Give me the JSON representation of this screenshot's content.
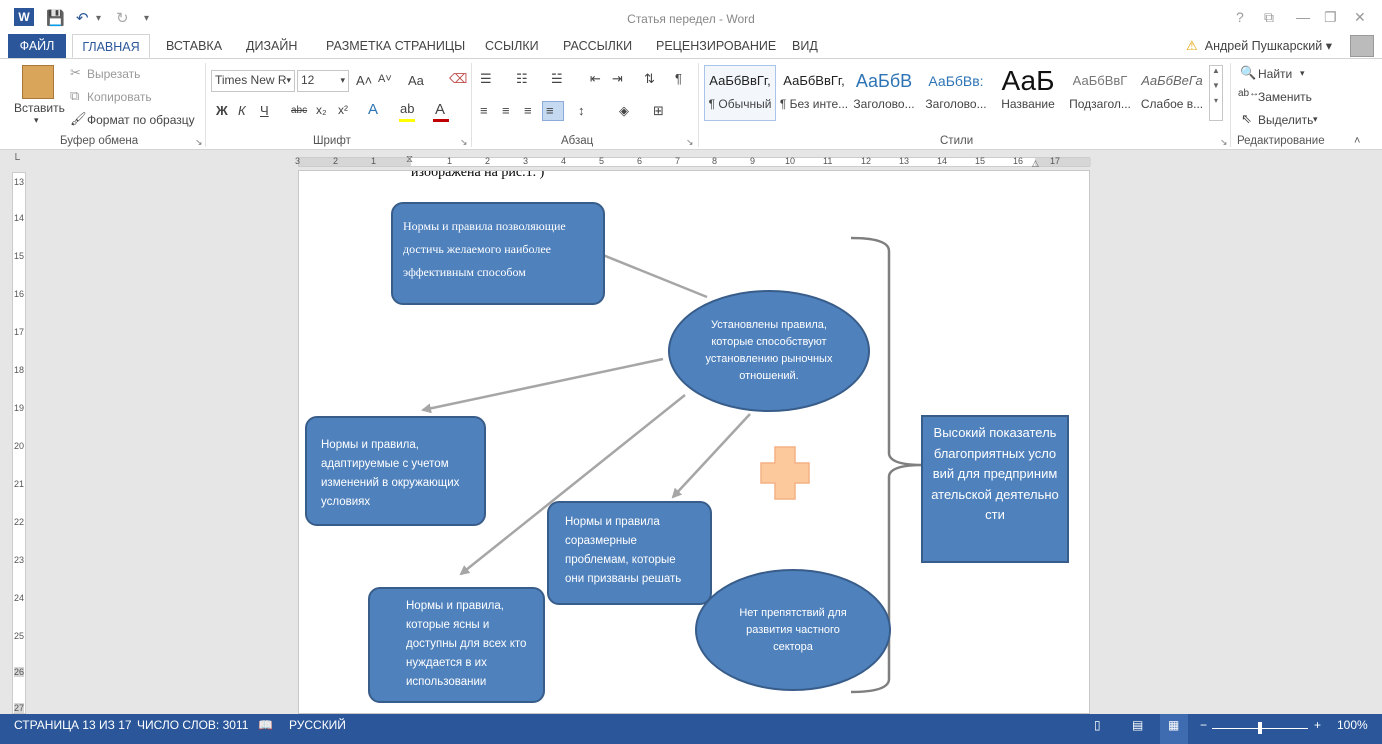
{
  "window": {
    "title": "Статья передел - Word",
    "controls": [
      "?",
      "⧉",
      "—",
      "❐",
      "✕"
    ]
  },
  "tabs": {
    "file": "ФАЙЛ",
    "items": [
      "ГЛАВНАЯ",
      "ВСТАВКА",
      "ДИЗАЙН",
      "РАЗМЕТКА СТРАНИЦЫ",
      "ССЫЛКИ",
      "РАССЫЛКИ",
      "РЕЦЕНЗИРОВАНИЕ",
      "ВИД"
    ],
    "active": "ГЛАВНАЯ",
    "user": "Андрей Пушкарский"
  },
  "ribbon": {
    "clipboard": {
      "paste": "Вставить",
      "cut": "Вырезать",
      "copy": "Копировать",
      "format_painter": "Формат по образцу",
      "label": "Буфер обмена"
    },
    "font": {
      "name": "Times New R",
      "size": "12",
      "label": "Шрифт",
      "bold": "Ж",
      "italic": "К",
      "underline": "Ч",
      "strike": "abc",
      "sub": "x₂",
      "sup": "x²",
      "grow": "A˄",
      "shrink": "A˅",
      "case": "Aa"
    },
    "paragraph": {
      "label": "Абзац"
    },
    "styles": {
      "label": "Стили",
      "items": [
        {
          "preview": "АаБбВвГг,",
          "name": "¶ Обычный"
        },
        {
          "preview": "АаБбВвГг,",
          "name": "¶ Без инте..."
        },
        {
          "preview": "АаБбВ",
          "name": "Заголово..."
        },
        {
          "preview": "АаБбВв:",
          "name": "Заголово..."
        },
        {
          "preview": "АаБ",
          "name": "Название"
        },
        {
          "preview": "АаБбВвГ",
          "name": "Подзагол..."
        },
        {
          "preview": "АаБбВеГа",
          "name": "Слабое в..."
        }
      ]
    },
    "editing": {
      "find": "Найти",
      "replace": "Заменить",
      "select": "Выделить",
      "label": "Редактирование"
    }
  },
  "ruler": {
    "h_ticks": [
      "3",
      "2",
      "1",
      "1",
      "2",
      "3",
      "4",
      "5",
      "6",
      "7",
      "8",
      "9",
      "10",
      "11",
      "12",
      "13",
      "14",
      "15",
      "16",
      "17"
    ],
    "v_ticks": [
      "13",
      "14",
      "15",
      "16",
      "17",
      "18",
      "19",
      "20",
      "21",
      "22",
      "23",
      "24",
      "25",
      "26",
      "27"
    ]
  },
  "document": {
    "top_text": "изображена на рис.1.  )",
    "box_top": "Нормы и правила позволяющие достичь желаемого наиболее эффективным способом",
    "ellipse_center": "Установлены правила, которые способствуют установлению рыночных отношений.",
    "box_left": "Нормы и правила, адаптируемые с учетом изменений в окружающих условиях",
    "box_mid": "Нормы и правила соразмерные проблемам, которые они призваны решать",
    "box_bottom": "Нормы и правила, которые ясны и доступны для всех кто нуждается в их использовании",
    "ellipse_bottom": "Нет препятствий для развития частного сектора",
    "box_right": "Высокий показатель благоприятных условий для предпринимательской деятельности"
  },
  "status": {
    "page": "СТРАНИЦА 13 ИЗ 17",
    "words": "ЧИСЛО СЛОВ: 3011",
    "language": "РУССКИЙ",
    "zoom": "100%"
  },
  "colors": {
    "accent": "#2b579a",
    "shape_fill": "#4f81bd",
    "shape_border": "#385d8a",
    "arrow": "#a6a6a6",
    "plus": "#fbc99b"
  }
}
